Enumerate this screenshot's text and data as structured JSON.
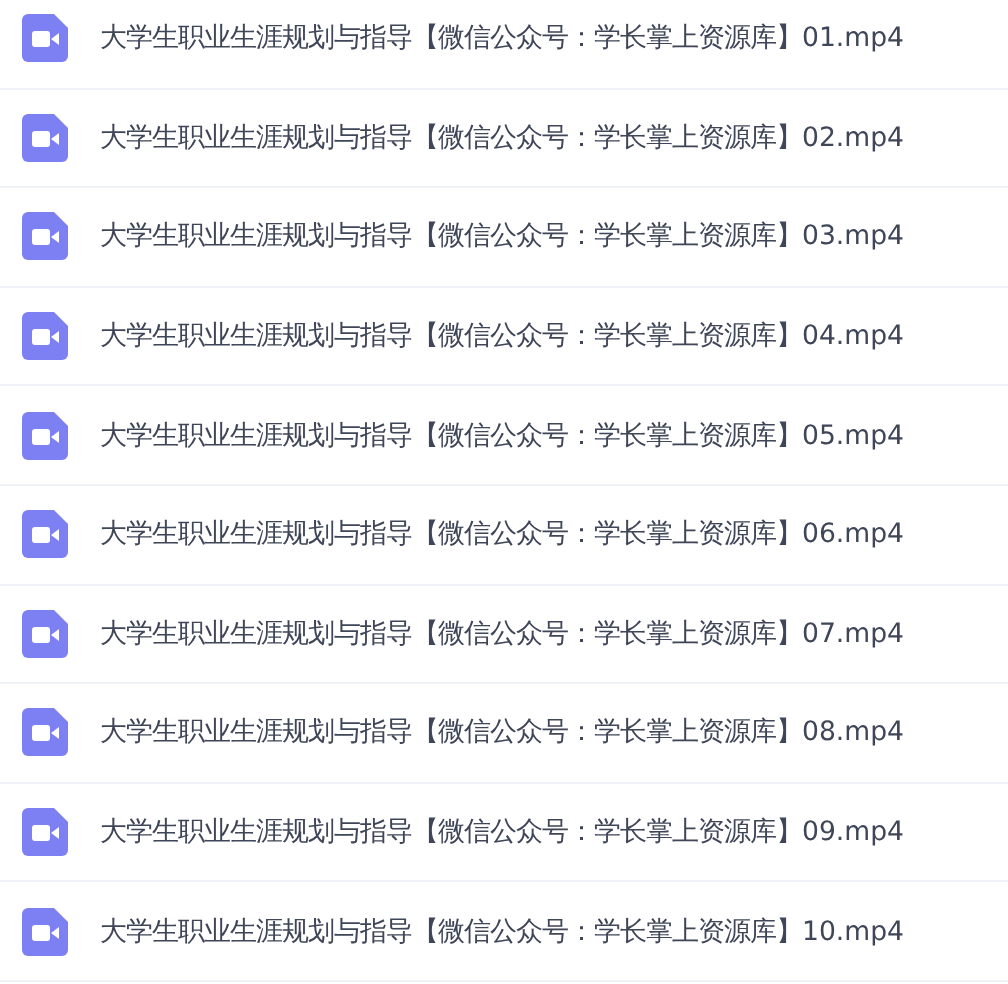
{
  "files": [
    {
      "name": "大学生职业生涯规划与指导【微信公众号：学长掌上资源库】01.mp4"
    },
    {
      "name": "大学生职业生涯规划与指导【微信公众号：学长掌上资源库】02.mp4"
    },
    {
      "name": "大学生职业生涯规划与指导【微信公众号：学长掌上资源库】03.mp4"
    },
    {
      "name": "大学生职业生涯规划与指导【微信公众号：学长掌上资源库】04.mp4"
    },
    {
      "name": "大学生职业生涯规划与指导【微信公众号：学长掌上资源库】05.mp4"
    },
    {
      "name": "大学生职业生涯规划与指导【微信公众号：学长掌上资源库】06.mp4"
    },
    {
      "name": "大学生职业生涯规划与指导【微信公众号：学长掌上资源库】07.mp4"
    },
    {
      "name": "大学生职业生涯规划与指导【微信公众号：学长掌上资源库】08.mp4"
    },
    {
      "name": "大学生职业生涯规划与指导【微信公众号：学长掌上资源库】09.mp4"
    },
    {
      "name": "大学生职业生涯规划与指导【微信公众号：学长掌上资源库】10.mp4"
    }
  ]
}
